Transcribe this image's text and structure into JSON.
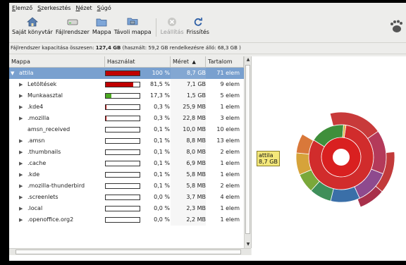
{
  "menu": [
    "Elemző",
    "Szerkesztés",
    "Nézet",
    "Súgó"
  ],
  "toolbar": {
    "home": "Saját könyvtár",
    "filesystem": "Fájlrendszer",
    "folder": "Mappa",
    "remote": "Távoli mappa",
    "stop": "Leállítás",
    "refresh": "Frissítés"
  },
  "status": {
    "prefix": "Fájlrendszer kapacitása összesen:",
    "total": "127,4 GB",
    "details": "(használt: 59,2 GB rendelkezésre álló: 68,3 GB )"
  },
  "columns": [
    "Mappa",
    "Használat",
    "Méret",
    "Tartalom"
  ],
  "sort_indicator": "▲",
  "rows": [
    {
      "name": "attila",
      "usage": 1.0,
      "pct": "100 %",
      "size": "8,7 GB",
      "count": "71 elem",
      "expanded": true,
      "selected": true,
      "color": "#c00000"
    },
    {
      "name": "Letöltések",
      "usage": 0.815,
      "pct": "81,5 %",
      "size": "7,1 GB",
      "count": "9 elem",
      "expanded": false,
      "color": "#c00000"
    },
    {
      "name": "Munkaasztal",
      "usage": 0.173,
      "pct": "17,3 %",
      "size": "1,5 GB",
      "count": "5 elem",
      "expanded": false,
      "color": "#4caa22"
    },
    {
      "name": ".kde4",
      "usage": 0.003,
      "pct": "0,3 %",
      "size": "25,9 MB",
      "count": "1 elem",
      "expanded": false
    },
    {
      "name": ".mozilla",
      "usage": 0.003,
      "pct": "0,3 %",
      "size": "22,8 MB",
      "count": "3 elem",
      "expanded": false
    },
    {
      "name": "amsn_received",
      "usage": 0.001,
      "pct": "0,1 %",
      "size": "10,0 MB",
      "count": "10 elem",
      "leaf": true
    },
    {
      "name": ".amsn",
      "usage": 0.001,
      "pct": "0,1 %",
      "size": "8,8 MB",
      "count": "13 elem",
      "expanded": false
    },
    {
      "name": ".thumbnails",
      "usage": 0.001,
      "pct": "0,1 %",
      "size": "8,0 MB",
      "count": "2 elem",
      "expanded": false
    },
    {
      "name": ".cache",
      "usage": 0.001,
      "pct": "0,1 %",
      "size": "6,9 MB",
      "count": "1 elem",
      "expanded": false
    },
    {
      "name": ".kde",
      "usage": 0.001,
      "pct": "0,1 %",
      "size": "5,8 MB",
      "count": "1 elem",
      "expanded": false
    },
    {
      "name": ".mozilla-thunderbird",
      "usage": 0.001,
      "pct": "0,1 %",
      "size": "5,8 MB",
      "count": "2 elem",
      "expanded": false
    },
    {
      "name": ".screenlets",
      "usage": 0.0,
      "pct": "0,0 %",
      "size": "3,7 MB",
      "count": "4 elem",
      "expanded": false
    },
    {
      "name": ".local",
      "usage": 0.0,
      "pct": "0,0 %",
      "size": "2,3 MB",
      "count": "1 elem",
      "expanded": false
    },
    {
      "name": ".openoffice.org2",
      "usage": 0.0,
      "pct": "0,0 %",
      "size": "2,2 MB",
      "count": "1 elem",
      "expanded": false
    }
  ],
  "ring_chart": {
    "tooltip_name": "attila",
    "tooltip_size": "8,7 GB",
    "center_color": "#ffffff",
    "ring1": [
      {
        "value": 81.5,
        "color": "#d12c2c"
      },
      {
        "value": 17.3,
        "color": "#3f8f3b"
      },
      {
        "value": 1.2,
        "color": "#e0b040"
      }
    ],
    "ring2": [
      {
        "value": 22,
        "color": "#c83a3a"
      },
      {
        "value": 18,
        "color": "#b43a5a"
      },
      {
        "value": 14,
        "color": "#8e4a8e"
      },
      {
        "value": 12,
        "color": "#3a6fa8"
      },
      {
        "value": 9,
        "color": "#3f8f5a"
      },
      {
        "value": 8,
        "color": "#7aa83a"
      },
      {
        "value": 9,
        "color": "#d6a33a"
      },
      {
        "value": 8,
        "color": "#d9783a"
      }
    ]
  }
}
